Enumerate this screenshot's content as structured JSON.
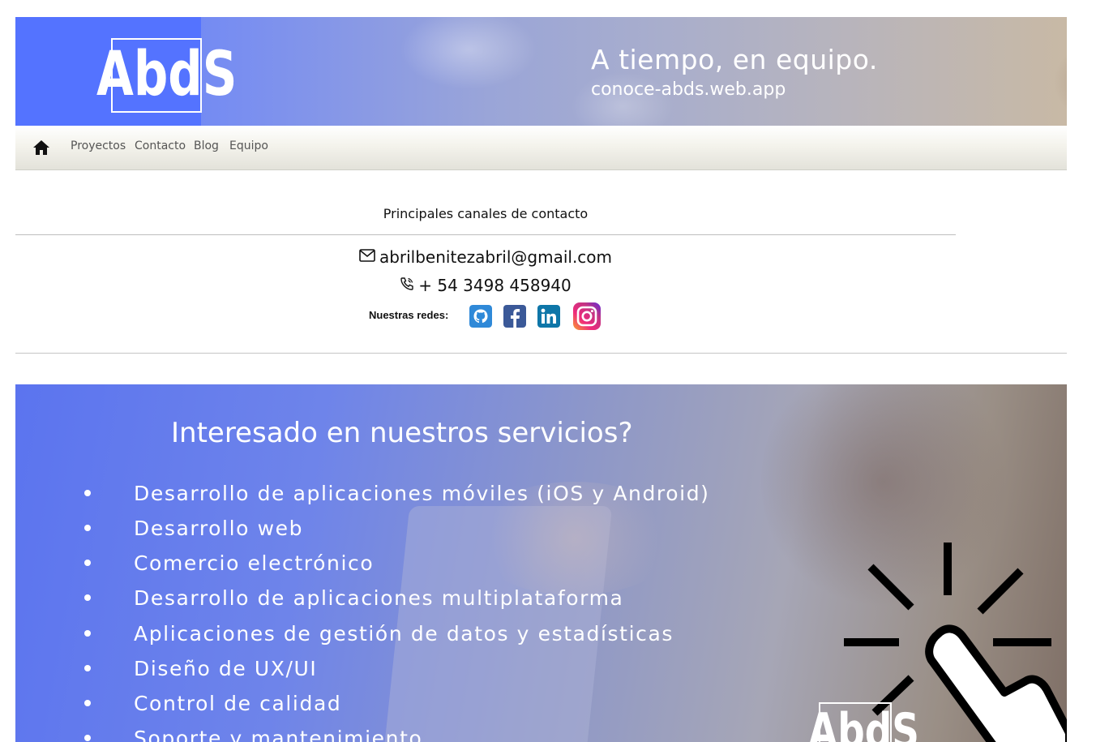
{
  "header": {
    "logo_text": "AbdS",
    "tagline": "A tiempo, en equipo.",
    "url": "conoce-abds.web.app"
  },
  "nav": {
    "home_icon": "home-icon",
    "links": [
      "Proyectos",
      "Contacto",
      "Blog",
      "Equipo"
    ]
  },
  "contact": {
    "title": "Principales canales de contacto",
    "email": "abrilbenitezabril@gmail.com",
    "phone": "+ 54 3498 458940",
    "social_label": "Nuestras redes:",
    "social_icons": [
      "github-icon",
      "facebook-icon",
      "linkedin-icon",
      "instagram-icon"
    ]
  },
  "services": {
    "title": "Interesado en nuestros servicios?",
    "items": [
      "Desarrollo de aplicaciones móviles (iOS y Android)",
      "Desarrollo web",
      "Comercio electrónico",
      "Desarrollo de aplicaciones multiplataforma",
      "Aplicaciones de gestión de datos y estadísticas",
      "Diseño de UX/UI",
      "Control de calidad",
      "Soporte y mantenimiento"
    ],
    "logo_text": "AbdS"
  },
  "colors": {
    "brand_blue": "#5473ff",
    "nav_text": "#555555",
    "github": "#2f89d8",
    "facebook": "#3b5998",
    "linkedin": "#0e76a8",
    "instagram": "#c13584"
  }
}
